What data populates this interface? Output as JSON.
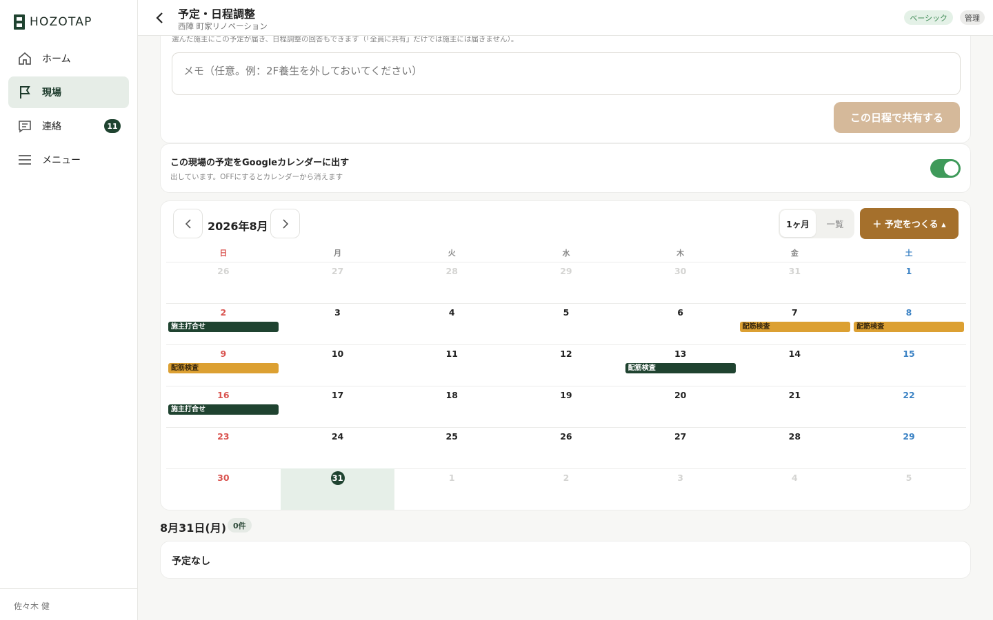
{
  "sidebar": {
    "brand": "HOZOTAP",
    "items": [
      {
        "label": "ホーム",
        "icon": "home-icon"
      },
      {
        "label": "現場",
        "icon": "flag-icon",
        "active": true
      },
      {
        "label": "連絡",
        "icon": "message-icon",
        "badge": "11"
      },
      {
        "label": "メニュー",
        "icon": "menu-icon"
      }
    ],
    "user": "佐々木 健"
  },
  "header": {
    "title": "予定・日程調整",
    "subtitle": "西陣 町家リノベーション",
    "plan_badge": "ベーシック",
    "admin_badge": "管理"
  },
  "share": {
    "note": "選んだ施主にこの予定が届き、日程調整の回答もできます（「全員に共有」だけでは施主には届きません）。",
    "memo_placeholder": "メモ（任意。例：2F養生を外しておいてください）",
    "share_button": "この日程で共有する"
  },
  "gcal": {
    "title": "この現場の予定をGoogleカレンダーに出す",
    "subtitle": "出しています。OFFにするとカレンダーから消えます",
    "enabled": true
  },
  "calendar": {
    "month": "2026年8月",
    "view_month": "1ヶ月",
    "view_list": "一覧",
    "create_button": "＋ 予定をつくる ▴",
    "weekdays": [
      "日",
      "月",
      "火",
      "水",
      "木",
      "金",
      "土"
    ],
    "weeks": [
      [
        "26",
        "27",
        "28",
        "29",
        "30",
        "31",
        "1"
      ],
      [
        "2",
        "3",
        "4",
        "5",
        "6",
        "7",
        "8"
      ],
      [
        "9",
        "10",
        "11",
        "12",
        "13",
        "14",
        "15"
      ],
      [
        "16",
        "17",
        "18",
        "19",
        "20",
        "21",
        "22"
      ],
      [
        "23",
        "24",
        "25",
        "26",
        "27",
        "28",
        "29"
      ],
      [
        "30",
        "31",
        "1",
        "2",
        "3",
        "4",
        "5"
      ]
    ],
    "events": [
      {
        "week": 1,
        "day": 0,
        "label": "施主打合せ",
        "kind": "meeting"
      },
      {
        "week": 1,
        "day": 5,
        "label": "配筋検査",
        "kind": "inspection"
      },
      {
        "week": 1,
        "day": 6,
        "label": "配筋検査",
        "kind": "inspection"
      },
      {
        "week": 2,
        "day": 0,
        "label": "配筋検査",
        "kind": "inspection"
      },
      {
        "week": 2,
        "day": 4,
        "label": "配筋検査",
        "kind": "meeting"
      },
      {
        "week": 3,
        "day": 0,
        "label": "施主打合せ",
        "kind": "meeting"
      }
    ],
    "today": "31",
    "colors": {
      "sunday": "#d9534f",
      "saturday": "#3b82c4",
      "weekday": "#222222",
      "muted": "#d4d4d2",
      "meeting": "#1f4330",
      "inspection": "#dca032"
    }
  },
  "selected_day": {
    "date": "8月31日(月)",
    "count": "0件",
    "empty": "予定なし"
  }
}
